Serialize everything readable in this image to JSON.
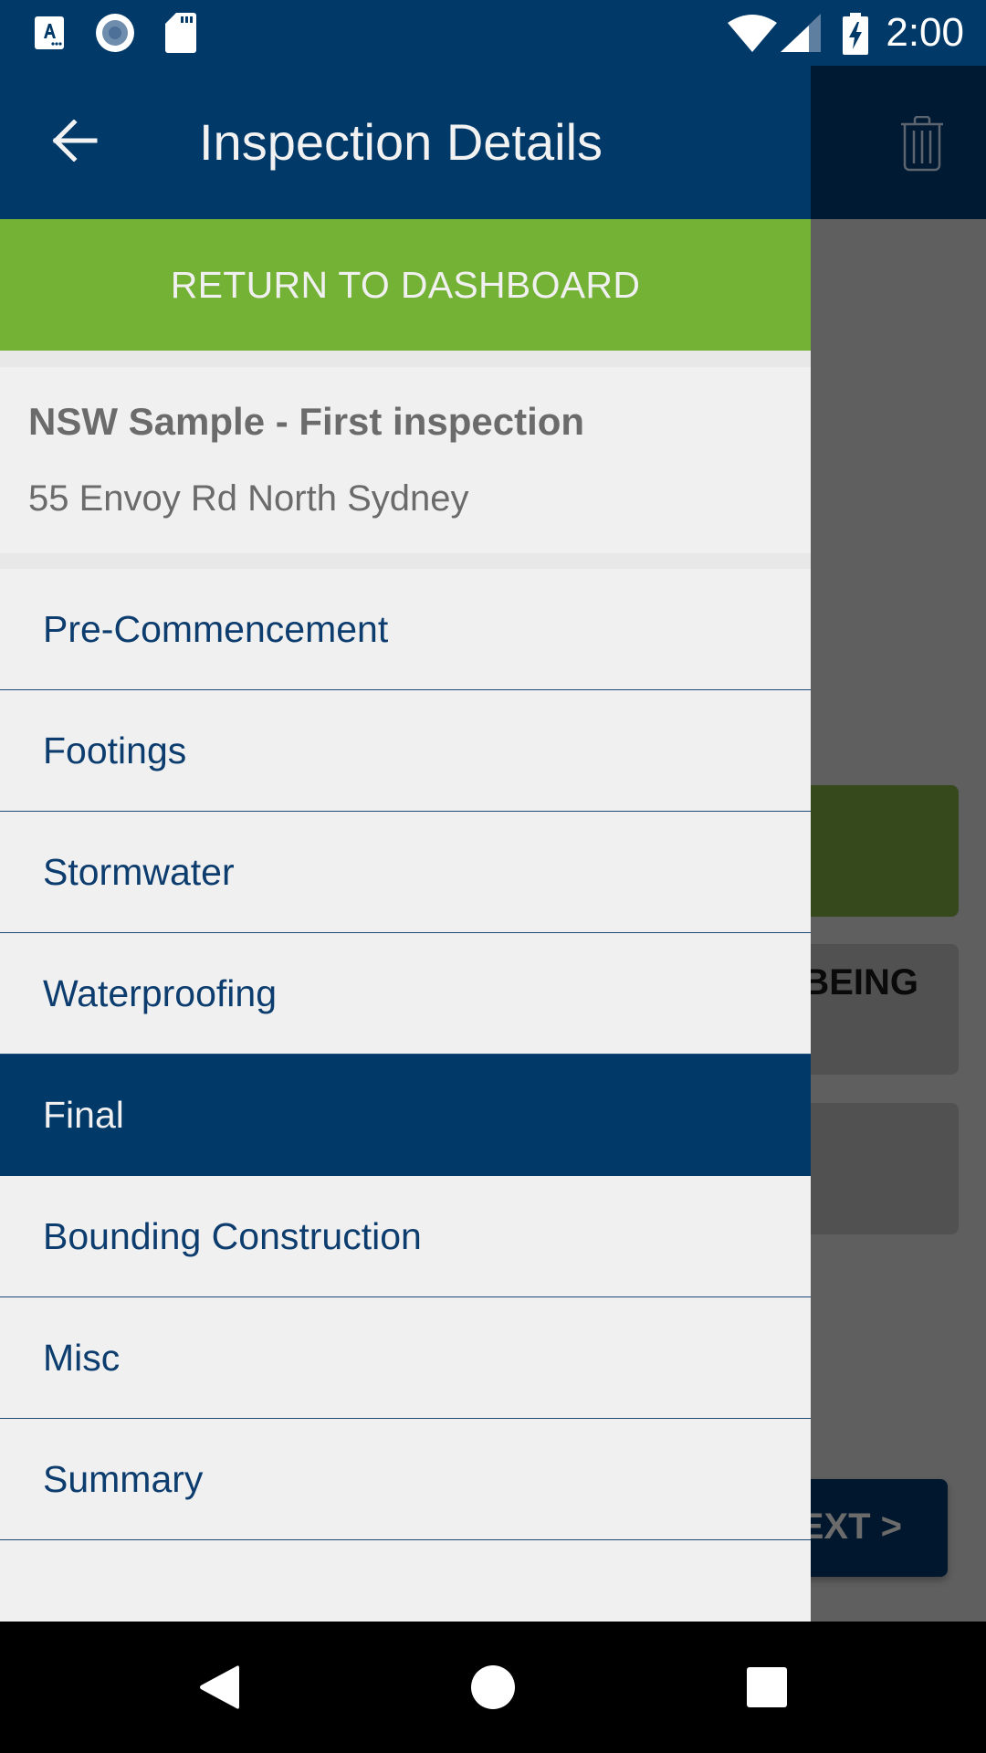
{
  "status_bar": {
    "left_icons": [
      "accessibility-a-icon",
      "record-circle-icon",
      "sd-card-icon"
    ],
    "right_icons": [
      "wifi-icon",
      "cell-signal-icon",
      "battery-charging-icon"
    ],
    "time": "2:00"
  },
  "background_screen": {
    "toolbar_icons": [
      "trash-icon"
    ],
    "card_partial_text": "BEING",
    "next_button_label": "NEXT >",
    "colors": {
      "green_card": "#35491c",
      "gray_card": "#515151",
      "next_button": "#00172e"
    }
  },
  "drawer": {
    "header": {
      "title": "Inspection Details",
      "back_icon": "arrow-left-icon"
    },
    "return_button_label": "RETURN TO DASHBOARD",
    "inspection": {
      "name": "NSW Sample - First inspection",
      "address": "55 Envoy Rd North Sydney"
    },
    "items": [
      {
        "label": "Pre-Commencement",
        "active": false
      },
      {
        "label": "Footings",
        "active": false
      },
      {
        "label": "Stormwater",
        "active": false
      },
      {
        "label": "Waterproofing",
        "active": false
      },
      {
        "label": "Final",
        "active": true
      },
      {
        "label": "Bounding Construction",
        "active": false
      },
      {
        "label": "Misc",
        "active": false
      },
      {
        "label": "Summary",
        "active": false
      }
    ],
    "colors": {
      "primary": "#013968",
      "accent_green": "#73b234",
      "item_text": "#0d3d6e",
      "muted_text": "#6b6b6b"
    }
  },
  "nav_bar": {
    "buttons": [
      "back",
      "home",
      "recents"
    ]
  }
}
